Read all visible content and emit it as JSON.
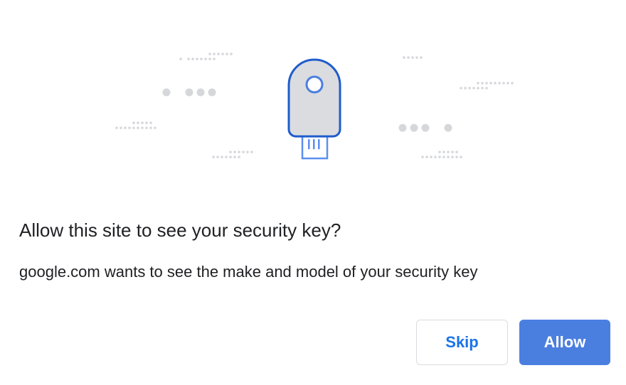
{
  "dialog": {
    "title": "Allow this site to see your security key?",
    "body": "google.com wants to see the make and model of your security key",
    "buttons": {
      "skip_label": "Skip",
      "allow_label": "Allow"
    }
  },
  "illustration": {
    "icon": "security-key-icon"
  },
  "colors": {
    "accent": "#1a73e8",
    "primary_button": "#4a7fe0",
    "key_fill": "#dadce0",
    "key_outline": "#1f5ccc",
    "usb_connector": "#5b8ef0",
    "dots": "#dadce0",
    "text": "#202124"
  }
}
